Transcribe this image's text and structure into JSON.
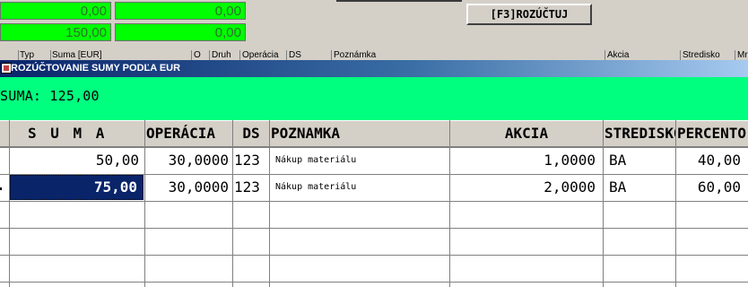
{
  "top": {
    "fields_left": [
      "0,00",
      "150,00"
    ],
    "fields_right": [
      "0,00",
      "0,00"
    ],
    "button_f3": "[F3]ROZÚČTUJ"
  },
  "background_table": {
    "headers": [
      "Typ",
      "Suma [EUR]",
      "O",
      "Druh",
      "Operácia",
      "DS",
      "Poznámka",
      "Akcia",
      "Stredisko",
      "Mr"
    ]
  },
  "dialog": {
    "title": "ROZÚČTOVANIE SUMY PODĽA EUR",
    "sum_line": "SUMA: 125,00"
  },
  "grid": {
    "columns": [
      "S U M A",
      "OPERÁCIA",
      "DS",
      "POZNAMKA",
      "AKCIA",
      "STREDISKO",
      "PERCENTO"
    ],
    "rows": [
      {
        "suma": "50,00",
        "operacia": "30,0000",
        "ds": "123",
        "poznamka": "Nákup materiálu",
        "akcia": "1,0000",
        "stredisko": "BA",
        "percento": "40,00"
      },
      {
        "suma": "75,00",
        "operacia": "30,0000",
        "ds": "123",
        "poznamka": "Nákup materiálu",
        "akcia": "2,0000",
        "stredisko": "BA",
        "percento": "60,00"
      }
    ],
    "selected_row": 1,
    "selected_color": "#0a246a",
    "band_color": "#00ff7f",
    "field_color": "#00ff00"
  }
}
